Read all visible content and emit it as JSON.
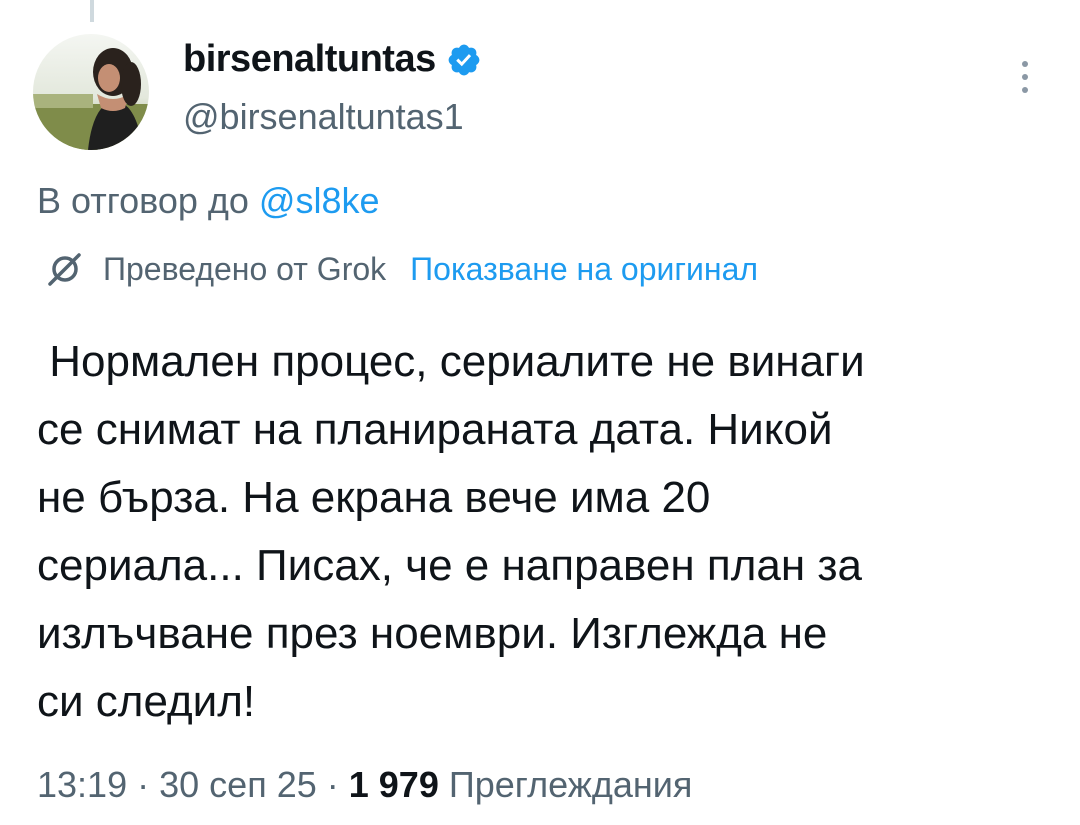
{
  "post": {
    "author": {
      "display_name": "birsenaltuntas",
      "handle": "@birsenaltuntas1",
      "verified": true,
      "avatar_icon": "profile-photo"
    },
    "reply_context": {
      "prefix": "В отговор до",
      "mention": "@sl8ke"
    },
    "translation": {
      "icon": "translate-icon",
      "translated_by": "Преведено от Grok",
      "show_original": "Показване на оригинал"
    },
    "text": " Нормален процес, сериалите не винаги\nсе снимат на планираната дата. Никой\nне бърза. На екрана вече има 20\nсериала... Писах, че е направен план за\nизлъчване през ноември. Изглежда не\nси следил!",
    "time": "13:19",
    "date": "30 сеп 25",
    "separator": "·",
    "views_count": "1 979",
    "views_label": "Преглеждания"
  },
  "colors": {
    "accent": "#1d9bf0",
    "secondary_text": "#536471",
    "primary_text": "#0f1419"
  }
}
